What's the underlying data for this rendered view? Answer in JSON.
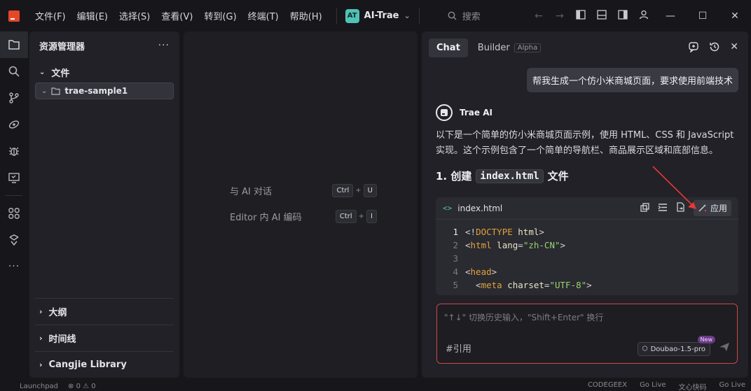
{
  "menu": [
    "文件(F)",
    "编辑(E)",
    "选择(S)",
    "查看(V)",
    "转到(G)",
    "终端(T)",
    "帮助(H)"
  ],
  "project": {
    "badge": "AT",
    "name": "AI-Trae"
  },
  "search": {
    "label": "搜索"
  },
  "explorer": {
    "title": "资源管理器",
    "more": "···",
    "files_section": "文件",
    "folder": "trae-sample1",
    "outline": "大纲",
    "timeline": "时间线",
    "cangjie": "Cangjie Library"
  },
  "editor_hints": [
    {
      "label": "与 AI 对话",
      "keys": [
        "Ctrl",
        "U"
      ]
    },
    {
      "label": "Editor 内 AI 编码",
      "keys": [
        "Ctrl",
        "I"
      ]
    }
  ],
  "chat": {
    "tab_chat": "Chat",
    "tab_builder": "Builder",
    "builder_badge": "Alpha",
    "user_message": "帮我生成一个仿小米商城页面，要求使用前端技术",
    "ai_name": "Trae AI",
    "ai_intro": "以下是一个简单的仿小米商城页面示例，使用 HTML、CSS 和 JavaScript 实现。这个示例包含了一个简单的导航栏、商品展示区域和底部信息。",
    "step_prefix": "1. 创建",
    "step_code": "index.html",
    "step_suffix": "文件",
    "code_filename": "index.html",
    "apply_label": "应用",
    "code_lines": [
      {
        "n": "1",
        "parts": [
          [
            "p",
            "<!"
          ],
          [
            "k",
            "DOCTYPE"
          ],
          [
            "p",
            " "
          ],
          [
            "s",
            "html"
          ],
          [
            "p",
            ">"
          ]
        ]
      },
      {
        "n": "2",
        "parts": [
          [
            "p",
            "<"
          ],
          [
            "k",
            "html"
          ],
          [
            "p",
            " "
          ],
          [
            "s",
            "lang"
          ],
          [
            "p",
            "="
          ],
          [
            "a",
            "\"zh-CN\""
          ],
          [
            "p",
            ">"
          ]
        ]
      },
      {
        "n": "3",
        "parts": []
      },
      {
        "n": "4",
        "parts": [
          [
            "p",
            "<"
          ],
          [
            "k",
            "head"
          ],
          [
            "p",
            ">"
          ]
        ]
      },
      {
        "n": "5",
        "parts": [
          [
            "p",
            "  <"
          ],
          [
            "k",
            "meta"
          ],
          [
            "p",
            " "
          ],
          [
            "s",
            "charset"
          ],
          [
            "p",
            "="
          ],
          [
            "a",
            "\"UTF-8\""
          ],
          [
            "p",
            ">"
          ]
        ]
      }
    ],
    "input_placeholder": "\"↑↓\" 切换历史输入，\"Shift+Enter\" 换行",
    "ref_label": "#引用",
    "model": "Doubao-1.5-pro",
    "model_badge": "New"
  },
  "status": {
    "left": [
      "Launchpad",
      "⊗ 0 ⚠ 0"
    ],
    "right": [
      "CODEGEEX",
      "Go Live",
      "文心快码",
      "Go Live"
    ]
  },
  "colors": {
    "accent": "#4fc3b7",
    "logo": "#e5472b",
    "annotation": "#e53935"
  }
}
